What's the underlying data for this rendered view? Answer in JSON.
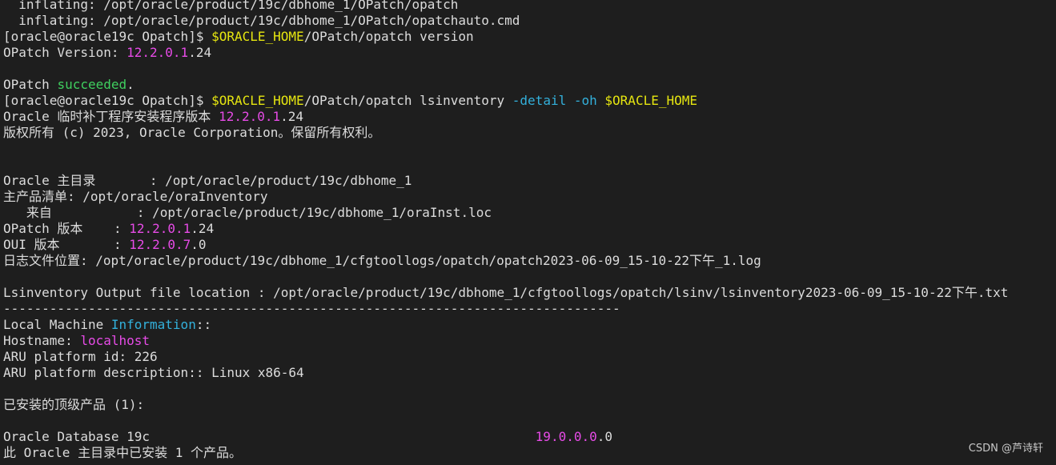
{
  "colors": {
    "background": "#1e1e1e",
    "text": "#dcdcdc",
    "yellow": "#e5e510",
    "magenta": "#e74be7",
    "green": "#3fcf5f",
    "cyan": "#33b0db"
  },
  "terminal": {
    "lines": [
      [
        {
          "t": "  inflating: /opt/oracle/product/19c/dbhome_1/OPatch/opatch",
          "c": ""
        }
      ],
      [
        {
          "t": "  inflating: /opt/oracle/product/19c/dbhome_1/OPatch/opatchauto.cmd",
          "c": ""
        }
      ],
      [
        {
          "t": "[oracle@oracle19c Opatch]$ ",
          "c": ""
        },
        {
          "t": "$ORACLE_HOME",
          "c": "yellow"
        },
        {
          "t": "/OPatch/opatch version",
          "c": ""
        }
      ],
      [
        {
          "t": "OPatch Version: ",
          "c": ""
        },
        {
          "t": "12.2.0.1",
          "c": "magenta"
        },
        {
          "t": ".24",
          "c": ""
        }
      ],
      [
        {
          "t": "",
          "c": ""
        }
      ],
      [
        {
          "t": "OPatch ",
          "c": ""
        },
        {
          "t": "succeeded",
          "c": "green"
        },
        {
          "t": ".",
          "c": ""
        }
      ],
      [
        {
          "t": "[oracle@oracle19c Opatch]$ ",
          "c": ""
        },
        {
          "t": "$ORACLE_HOME",
          "c": "yellow"
        },
        {
          "t": "/OPatch/opatch lsinventory ",
          "c": ""
        },
        {
          "t": "-detail",
          "c": "cyan"
        },
        {
          "t": " ",
          "c": ""
        },
        {
          "t": "-oh",
          "c": "cyan"
        },
        {
          "t": " ",
          "c": ""
        },
        {
          "t": "$ORACLE_HOME",
          "c": "yellow"
        }
      ],
      [
        {
          "t": "Oracle 临时补丁程序安装程序版本 ",
          "c": ""
        },
        {
          "t": "12.2.0.1",
          "c": "magenta"
        },
        {
          "t": ".24",
          "c": ""
        }
      ],
      [
        {
          "t": "版权所有 (c) 2023, Oracle Corporation。保留所有权利。",
          "c": ""
        }
      ],
      [
        {
          "t": "",
          "c": ""
        }
      ],
      [
        {
          "t": "",
          "c": ""
        }
      ],
      [
        {
          "t": "Oracle 主目录       : /opt/oracle/product/19c/dbhome_1",
          "c": ""
        }
      ],
      [
        {
          "t": "主产品清单: /opt/oracle/oraInventory",
          "c": ""
        }
      ],
      [
        {
          "t": "   来自           : /opt/oracle/product/19c/dbhome_1/oraInst.loc",
          "c": ""
        }
      ],
      [
        {
          "t": "OPatch 版本    : ",
          "c": ""
        },
        {
          "t": "12.2.0.1",
          "c": "magenta"
        },
        {
          "t": ".24",
          "c": ""
        }
      ],
      [
        {
          "t": "OUI 版本       : ",
          "c": ""
        },
        {
          "t": "12.2.0.7",
          "c": "magenta"
        },
        {
          "t": ".0",
          "c": ""
        }
      ],
      [
        {
          "t": "日志文件位置: /opt/oracle/product/19c/dbhome_1/cfgtoollogs/opatch/opatch2023-06-09_15-10-22下午_1.log",
          "c": ""
        }
      ],
      [
        {
          "t": "",
          "c": ""
        }
      ],
      [
        {
          "t": "Lsinventory Output file location : /opt/oracle/product/19c/dbhome_1/cfgtoollogs/opatch/lsinv/lsinventory2023-06-09_15-10-22下午.txt",
          "c": ""
        }
      ],
      [
        {
          "t": "--------------------------------------------------------------------------------",
          "c": ""
        }
      ],
      [
        {
          "t": "Local Machine ",
          "c": ""
        },
        {
          "t": "Information",
          "c": "cyan"
        },
        {
          "t": "::",
          "c": ""
        }
      ],
      [
        {
          "t": "Hostname: ",
          "c": ""
        },
        {
          "t": "localhost",
          "c": "magenta"
        }
      ],
      [
        {
          "t": "ARU platform id: 226",
          "c": ""
        }
      ],
      [
        {
          "t": "ARU platform description:: Linux x86-64",
          "c": ""
        }
      ],
      [
        {
          "t": "",
          "c": ""
        }
      ],
      [
        {
          "t": "已安装的顶级产品 (1):",
          "c": ""
        }
      ],
      [
        {
          "t": "",
          "c": ""
        }
      ],
      [
        {
          "t": "Oracle Database 19c                                                  ",
          "c": ""
        },
        {
          "t": "19.0.0.0",
          "c": "magenta"
        },
        {
          "t": ".0",
          "c": ""
        }
      ],
      [
        {
          "t": "此 Oracle 主目录中已安装 1 个产品。",
          "c": ""
        }
      ]
    ]
  },
  "watermark": "CSDN @芦诗轩"
}
